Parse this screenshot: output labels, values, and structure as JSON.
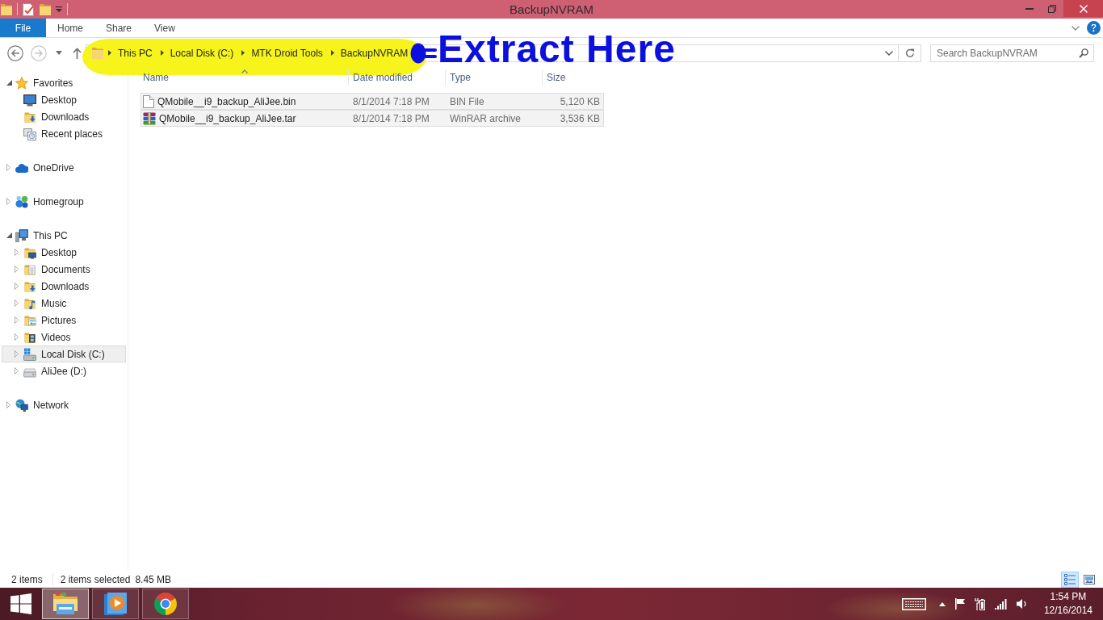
{
  "window": {
    "title": "BackupNVRAM"
  },
  "ribbon": {
    "tabs": [
      {
        "label": "File",
        "kind": "file"
      },
      {
        "label": "Home",
        "kind": "tab"
      },
      {
        "label": "Share",
        "kind": "tab"
      },
      {
        "label": "View",
        "kind": "tab"
      }
    ]
  },
  "nav_buttons": [
    {
      "kind": "back",
      "disabled": false
    },
    {
      "kind": "forward",
      "disabled": true
    }
  ],
  "address_bar": {
    "path": [
      "This PC",
      "Local Disk (C:)",
      "MTK Droid Tools",
      "BackupNVRAM"
    ]
  },
  "search": {
    "placeholder": "Search BackupNVRAM"
  },
  "annotation": {
    "text": "Extract Here"
  },
  "navigation": [
    {
      "label": "Favorites",
      "kind": "favorites",
      "expanded": true,
      "selected": false,
      "children": [
        {
          "label": "Desktop",
          "kind": "desktop",
          "selected": false
        },
        {
          "label": "Downloads",
          "kind": "downloads",
          "selected": false
        },
        {
          "label": "Recent places",
          "kind": "recent",
          "selected": false
        }
      ]
    },
    {
      "label": "OneDrive",
      "kind": "cloud",
      "expanded": false,
      "selected": false
    },
    {
      "label": "Homegroup",
      "kind": "homegroup",
      "expanded": false,
      "selected": false
    },
    {
      "label": "This PC",
      "kind": "computer",
      "expanded": true,
      "selected": false,
      "children": [
        {
          "label": "Desktop",
          "kind": "desktop-folder",
          "expanded": false,
          "selected": false
        },
        {
          "label": "Documents",
          "kind": "documents",
          "expanded": false,
          "selected": false
        },
        {
          "label": "Downloads",
          "kind": "downloads",
          "expanded": false,
          "selected": false
        },
        {
          "label": "Music",
          "kind": "music",
          "expanded": false,
          "selected": false
        },
        {
          "label": "Pictures",
          "kind": "pictures",
          "expanded": false,
          "selected": false
        },
        {
          "label": "Videos",
          "kind": "videos",
          "expanded": false,
          "selected": false
        },
        {
          "label": "Local Disk (C:)",
          "kind": "system-drive",
          "expanded": false,
          "selected": true
        },
        {
          "label": "AliJee (D:)",
          "kind": "drive",
          "expanded": false,
          "selected": false
        }
      ]
    },
    {
      "label": "Network",
      "kind": "network",
      "expanded": false,
      "selected": false
    }
  ],
  "file_list": {
    "columns": [
      {
        "label": "Name",
        "sorted": true
      },
      {
        "label": "Date modified",
        "sorted": false
      },
      {
        "label": "Type",
        "sorted": false
      },
      {
        "label": "Size",
        "sorted": false
      }
    ],
    "rows": [
      {
        "kind": "document",
        "name": "QMobile__i9_backup_AliJee.bin",
        "date_modified": "8/1/2014 7:18 PM",
        "type": "BIN File",
        "size": "5,120 KB",
        "selected": true
      },
      {
        "kind": "archive",
        "name": "QMobile__i9_backup_AliJee.tar",
        "date_modified": "8/1/2014 7:18 PM",
        "type": "WinRAR archive",
        "size": "3,536 KB",
        "selected": true
      }
    ]
  },
  "status_bar": {
    "item_count": "2 items",
    "selection": "2 items selected",
    "selection_size": "8.45 MB",
    "views": [
      {
        "kind": "details",
        "selected": true
      },
      {
        "kind": "large-icons",
        "selected": false
      }
    ]
  },
  "taskbar": {
    "apps": [
      {
        "kind": "file-explorer",
        "selected": true
      },
      {
        "kind": "media-player",
        "selected": false
      },
      {
        "kind": "browser",
        "selected": false
      }
    ],
    "clock": {
      "time": "1:54 PM",
      "date": "12/16/2014"
    }
  }
}
